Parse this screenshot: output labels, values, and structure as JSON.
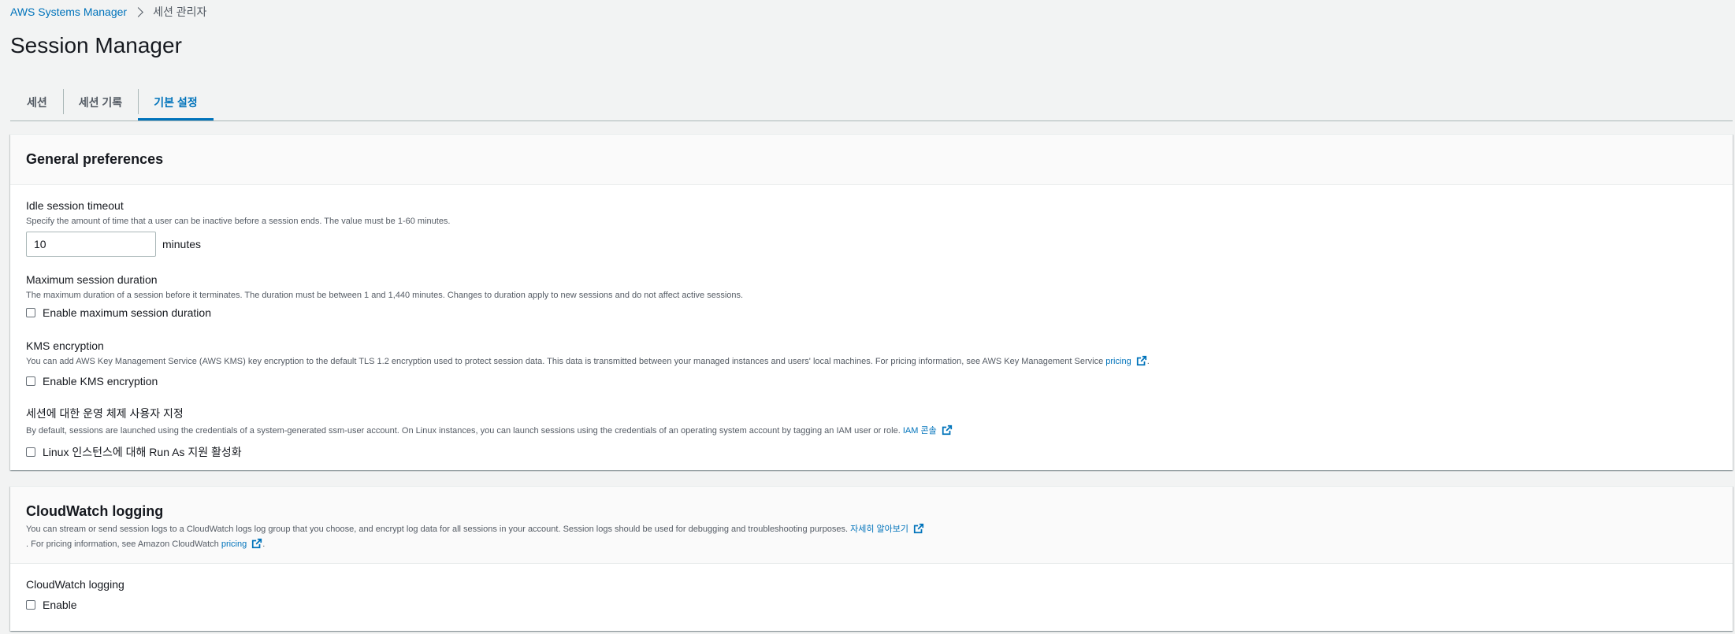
{
  "breadcrumb": {
    "root": "AWS Systems Manager",
    "current": "세션 관리자"
  },
  "page_title": "Session Manager",
  "tabs": [
    {
      "label": "세션",
      "active": false
    },
    {
      "label": "세션 기록",
      "active": false
    },
    {
      "label": "기본 설정",
      "active": true
    }
  ],
  "general": {
    "title": "General preferences",
    "idle": {
      "label": "Idle session timeout",
      "desc": "Specify the amount of time that a user can be inactive before a session ends. The value must be 1-60 minutes.",
      "value": "10",
      "unit": "minutes"
    },
    "max_duration": {
      "label": "Maximum session duration",
      "desc": "The maximum duration of a session before it terminates. The duration must be between 1 and 1,440 minutes. Changes to duration apply to new sessions and do not affect active sessions.",
      "checkbox_label": "Enable maximum session duration",
      "checked": false
    },
    "kms": {
      "label": "KMS encryption",
      "desc": "You can add AWS Key Management Service (AWS KMS) key encryption to the default TLS 1.2 encryption used to protect session data. This data is transmitted between your managed instances and users' local machines. For pricing information, see AWS Key Management Service",
      "link": "pricing",
      "trailing": ".",
      "checkbox_label": "Enable KMS encryption",
      "checked": false
    },
    "run_as": {
      "label": "세션에 대한 운영 체제 사용자 지정",
      "desc": "By default, sessions are launched using the credentials of a system-generated ssm-user account. On Linux instances, you can launch sessions using the credentials of an operating system account by tagging an IAM user or role.",
      "link": "IAM 콘솔",
      "checkbox_label": "Linux 인스턴스에 대해 Run As 지원 활성화",
      "checked": false
    }
  },
  "cloudwatch": {
    "title": "CloudWatch logging",
    "desc_line1": "You can stream or send session logs to a CloudWatch logs log group that you choose, and encrypt log data for all sessions in your account. Session logs should be used for debugging and troubleshooting purposes.",
    "learn_more": "자세히 알아보기",
    "desc_line2": ". For pricing information, see Amazon CloudWatch",
    "pricing_link": "pricing",
    "trailing": ".",
    "field_label": "CloudWatch logging",
    "checkbox_label": "Enable",
    "checked": false
  },
  "colors": {
    "link": "#0073bb",
    "page_bg": "#f2f3f3",
    "text": "#16191f",
    "muted": "#545b64"
  }
}
